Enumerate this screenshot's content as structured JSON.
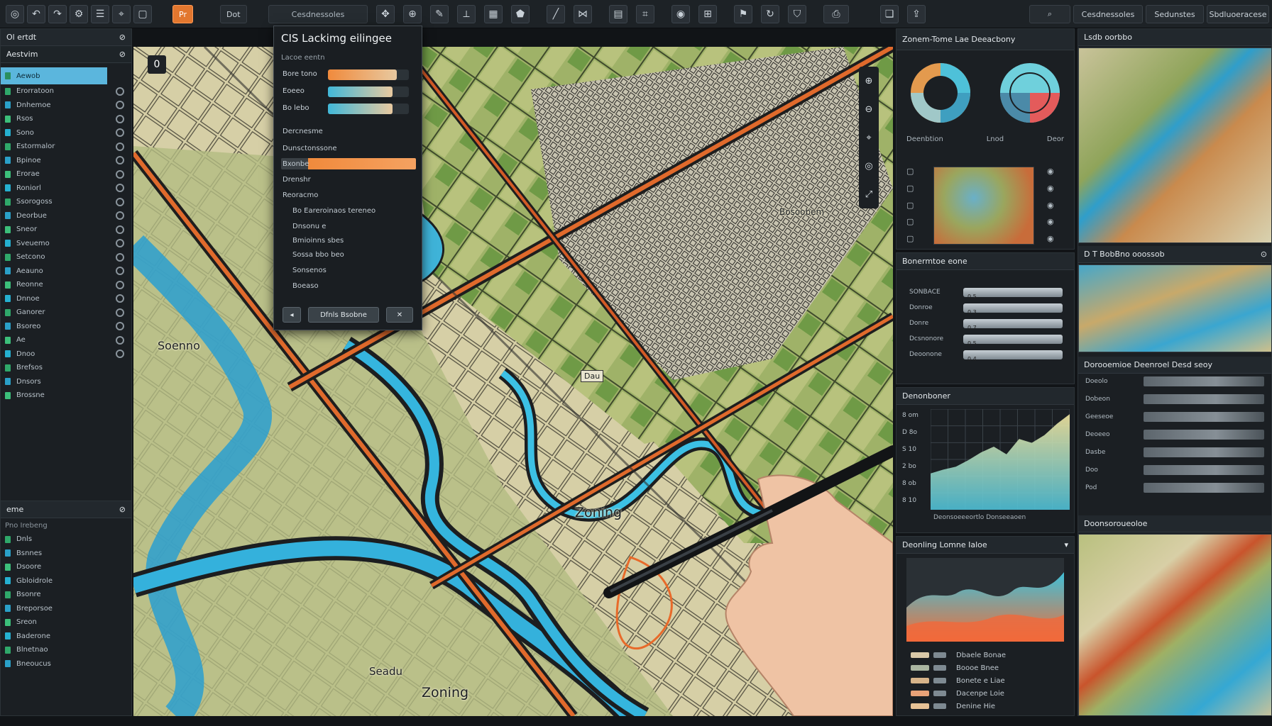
{
  "toolbar": {
    "menu": [
      "Pr",
      "Dot"
    ],
    "tabs": [
      "Cesdnessoles",
      "Sedunstes",
      "Sbdluoeracese"
    ],
    "icons": [
      "undo-icon",
      "redo-icon",
      "settings-icon",
      "layers-icon",
      "pin-icon",
      "select-icon",
      "pan-icon",
      "zoom-icon",
      "draw-icon",
      "measure-icon",
      "grid-icon",
      "camera-icon",
      "target-icon",
      "table-icon",
      "globe-icon",
      "flag-icon",
      "print-icon"
    ]
  },
  "left_panel": {
    "title": "Ol ertdt",
    "section": "Aestvim",
    "selected_layer": "Aewob",
    "layers": [
      "Erorratoon",
      "Dnhemoe",
      "Rsos",
      "Sono",
      "Estormalor",
      "Bpinoe",
      "Erorae",
      "Roniorl",
      "Ssorogoss",
      "Deorbue",
      "Sneor",
      "Sveuemo",
      "Setcono",
      "Aeauno",
      "Reonne",
      "Dnnoe",
      "Ganorer",
      "Bsoreo",
      "Ae",
      "Dnoo",
      "Brefsos",
      "Dnsors",
      "Brossne"
    ],
    "section2": "eme",
    "section2_sub": "Pno Irebeng",
    "layers2": [
      "Dnls",
      "Bsnnes",
      "Dsoore",
      "Gbloidrole",
      "Bsonre",
      "Breporsoe",
      "Sreon",
      "Baderone",
      "Blnetnao",
      "Bneoucus"
    ]
  },
  "gis_dialog": {
    "title": "CIS Lackimg eilingee",
    "subtitle": "Lacoe eentn",
    "sliders": [
      {
        "label": "Bore tono",
        "value": 0.85,
        "color": "#f08a3c"
      },
      {
        "label": "Eoeeo",
        "value": 0.8,
        "color": "#41b8d8"
      },
      {
        "label": "Bo lebo",
        "value": 0.8,
        "color": "#41b8d8"
      }
    ],
    "options": [
      "Dercnesme",
      "Dunsctonssone"
    ],
    "highlight": {
      "label": "Bxonbe",
      "value": 0.9
    },
    "items": [
      "Drenshr",
      "Reoracmo",
      "Bo Eareroinaos tereneo",
      "Dnsonu e",
      "Bmioinns sbes",
      "Sossa bbo beo",
      "Sonsenos",
      "Boeaso"
    ],
    "buttons": [
      "Dfnls Bsobne"
    ]
  },
  "map": {
    "labels": [
      "Soenno",
      "Zoning",
      "Zoning",
      "Seadu",
      "Dau",
      "Bosoobem"
    ]
  },
  "analysis_panel": {
    "title": "Zonem-Tome Lae Deeacbony",
    "donut_labels": [
      "Deenbtion",
      "Lnod",
      "Deor"
    ],
    "side_icons": [
      "zoom-in-icon",
      "zoom-out-icon",
      "filter-icon",
      "refresh-icon",
      "info-icon"
    ]
  },
  "props_panel": {
    "title": "Bonermtoe eone",
    "rows": [
      {
        "label": "SONBACE",
        "value": "0.5"
      },
      {
        "label": "Donroe",
        "value": "0.3"
      },
      {
        "label": "Donre",
        "value": "0.7"
      },
      {
        "label": "Dcsnonore",
        "value": "0.5"
      },
      {
        "label": "Deoonone",
        "value": "0.4"
      }
    ]
  },
  "histogram_panel": {
    "title": "Denonboner",
    "ticks": [
      "8 om",
      "D 8o",
      "S 10",
      "2 bo",
      "8 ob",
      "8 10"
    ],
    "xlabel": "Deonsoeeeortlo Donseeaoen",
    "values": [
      0.38,
      0.42,
      0.45,
      0.52,
      0.6,
      0.66,
      0.58,
      0.74,
      0.7,
      0.78,
      0.9,
      1.0
    ]
  },
  "area_panel": {
    "title": "Deonling  Lomne Ialoe",
    "legend": [
      {
        "label": "Dbaele Bonae",
        "color": "#d9c9a8"
      },
      {
        "label": "Boooe Bnee",
        "color": "#a9b5a0"
      },
      {
        "label": "Bonete e Liae",
        "color": "#d7b48a"
      },
      {
        "label": "Dacenpe Loie",
        "color": "#e8a278"
      },
      {
        "label": "Denine Hie",
        "color": "#e7c296"
      }
    ]
  },
  "right_panel": {
    "section1": "Lsdb oorbbo",
    "section2": "D T BobBno ooossob",
    "section3": "Dorooemioe Deenroel Desd seoy",
    "section4": "Doonsoroueoloe",
    "rows": [
      "Doeolo",
      "Dobeon",
      "Geeseoe",
      "Deoeeo",
      "Dasbe",
      "Doo",
      "Pod"
    ]
  },
  "colors": {
    "accent_orange": "#f08a3c",
    "accent_cyan": "#41b8d8",
    "selected_blue": "#5bb6dd"
  }
}
